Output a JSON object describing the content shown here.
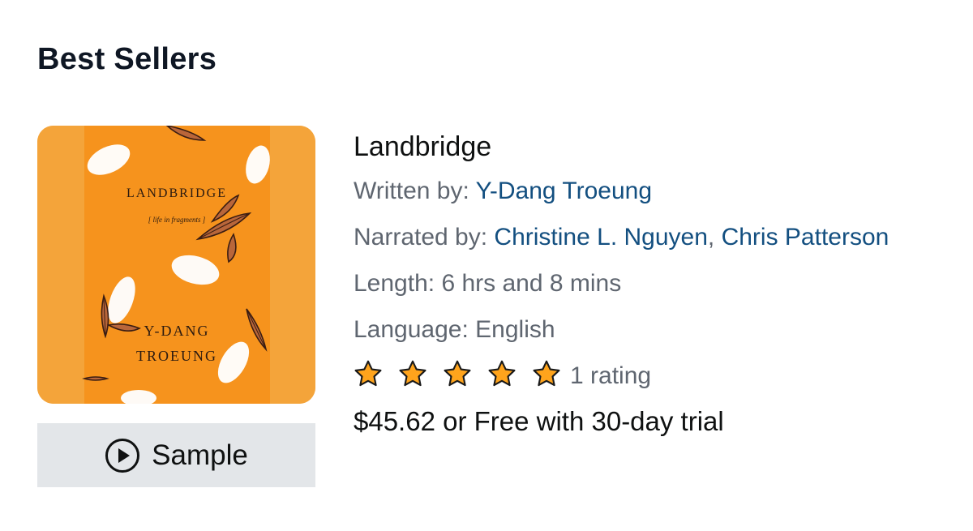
{
  "section": {
    "title": "Best Sellers"
  },
  "book": {
    "title": "Landbridge",
    "cover": {
      "title_text": "LANDBRIDGE",
      "subtitle_text": "[ life in fragments ]",
      "author_line1": "Y-DANG",
      "author_line2": "TROEUNG",
      "background_color": "#f6931d"
    },
    "written_by_label": "Written by:",
    "author": "Y-Dang Troeung",
    "narrated_by_label": "Narrated by:",
    "narrators": [
      "Christine L. Nguyen",
      "Chris Patterson"
    ],
    "narrator_separator": ",",
    "length_label": "Length:",
    "length_value": "6 hrs and 8 mins",
    "language_label": "Language:",
    "language_value": "English",
    "rating_stars": 5,
    "rating_count_text": "1 rating",
    "price_text": "$45.62 or Free with 30-day trial"
  },
  "sample_button": {
    "label": "Sample",
    "icon": "play-circle-icon"
  },
  "colors": {
    "link": "#134f80",
    "muted": "#5f6670",
    "star_fill": "#ffa41c",
    "button_bg": "#e3e6e9"
  }
}
